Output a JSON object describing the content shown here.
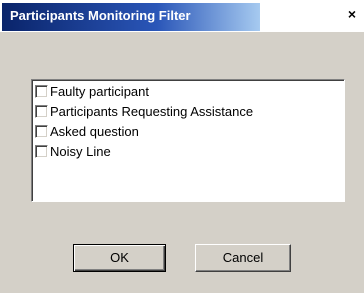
{
  "window": {
    "title": "Participants Monitoring Filter",
    "close_glyph": "×"
  },
  "filters": [
    {
      "label": "Faulty participant",
      "checked": false
    },
    {
      "label": "Participants Requesting Assistance",
      "checked": false
    },
    {
      "label": "Asked question",
      "checked": false
    },
    {
      "label": "Noisy Line",
      "checked": false
    }
  ],
  "buttons": {
    "ok_label": "OK",
    "cancel_label": "Cancel"
  }
}
